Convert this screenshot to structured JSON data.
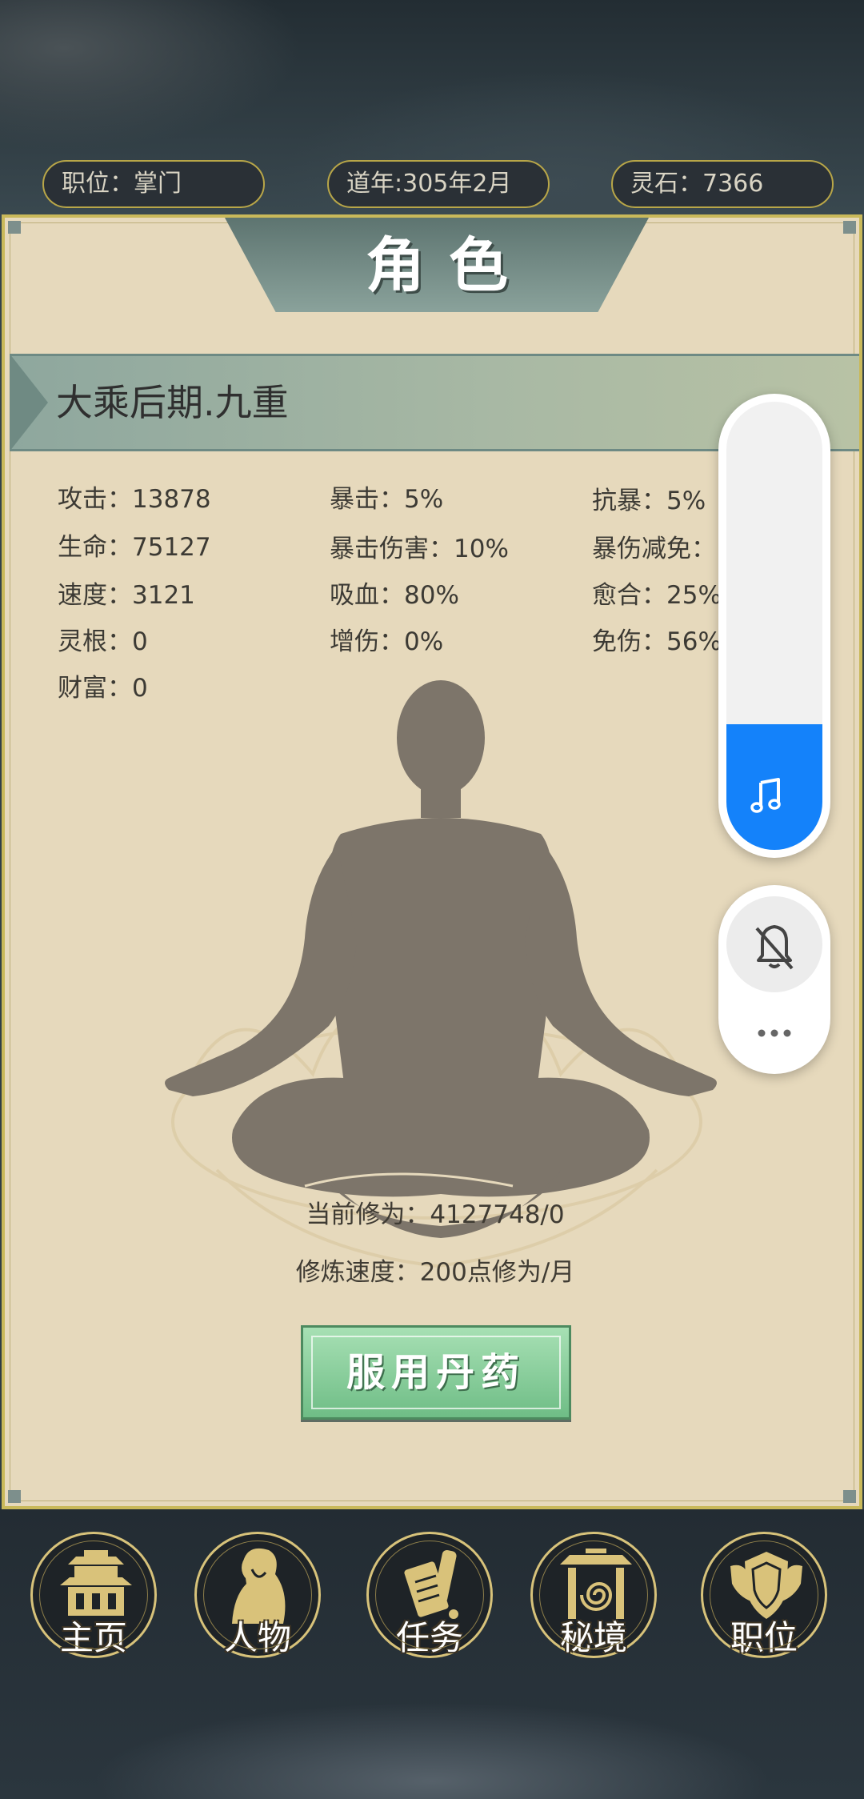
{
  "header": {
    "position": "职位：掌门",
    "dao_year": "道年:305年2月",
    "spirit_stone": "灵石：7366"
  },
  "panel": {
    "title": "角色",
    "realm": "大乘后期.九重",
    "stats": {
      "attack": "攻击：13878",
      "life": "生命：75127",
      "speed": "速度：3121",
      "spirit_root": "灵根：0",
      "wealth": "财富：0",
      "crit": "暴击：5%",
      "crit_damage": "暴击伤害：10%",
      "lifesteal": "吸血：80%",
      "damage_boost": "增伤：0%",
      "crit_resist": "抗暴：5%",
      "crit_damage_reduction": "暴伤减免：",
      "healing": "愈合：25%",
      "damage_immunity": "免伤：56%"
    },
    "cultivation": "当前修为：4127748/0",
    "cultivation_speed": "修炼速度：200点修为/月",
    "take_pill_button": "服用丹药"
  },
  "overlay": {
    "volume_level": 0.28,
    "volume_icon": "music-note-icon",
    "mute_icon": "bell-off-icon",
    "more_icon": "more-dots-icon",
    "accent": "#1482fa"
  },
  "nav": {
    "items": [
      {
        "label": "主页",
        "icon": "palace-icon"
      },
      {
        "label": "人物",
        "icon": "character-icon"
      },
      {
        "label": "任务",
        "icon": "scroll-icon"
      },
      {
        "label": "秘境",
        "icon": "gate-icon"
      },
      {
        "label": "职位",
        "icon": "shield-icon"
      }
    ]
  }
}
